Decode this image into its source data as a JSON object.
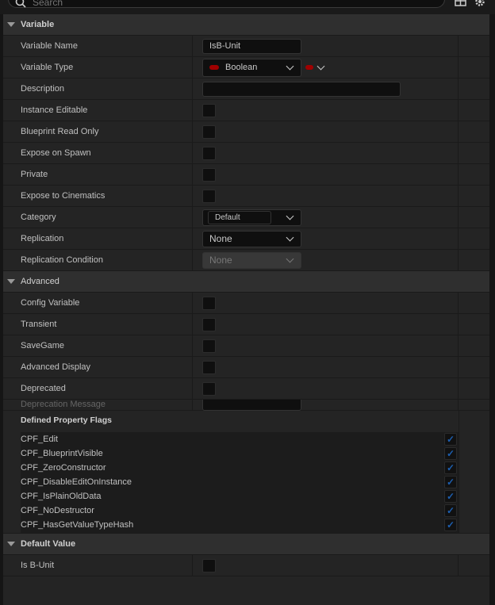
{
  "search": {
    "placeholder": "Search"
  },
  "sections": {
    "variable": "Variable",
    "advanced": "Advanced",
    "default_value": "Default Value"
  },
  "variable": {
    "name_label": "Variable Name",
    "name_value": "IsB-Unit",
    "type_label": "Variable Type",
    "type_value": "Boolean",
    "description_label": "Description",
    "description_value": "",
    "instance_editable": "Instance Editable",
    "blueprint_read_only": "Blueprint Read Only",
    "expose_on_spawn": "Expose on Spawn",
    "private": "Private",
    "expose_to_cinematics": "Expose to Cinematics",
    "category_label": "Category",
    "category_value": "Default",
    "replication_label": "Replication",
    "replication_value": "None",
    "replication_condition_label": "Replication Condition",
    "replication_condition_value": "None"
  },
  "advanced": {
    "config_variable": "Config Variable",
    "transient": "Transient",
    "savegame": "SaveGame",
    "advanced_display": "Advanced Display",
    "deprecated": "Deprecated",
    "deprecation_message": "Deprecation Message",
    "flags_title": "Defined Property Flags",
    "flags": [
      "CPF_Edit",
      "CPF_BlueprintVisible",
      "CPF_ZeroConstructor",
      "CPF_DisableEditOnInstance",
      "CPF_IsPlainOldData",
      "CPF_NoDestructor",
      "CPF_HasGetValueTypeHash"
    ],
    "check": "✓"
  },
  "default_value": {
    "label": "Is B-Unit"
  },
  "colors": {
    "boolean_pin": "#a00000",
    "check": "#1d5fb0"
  }
}
